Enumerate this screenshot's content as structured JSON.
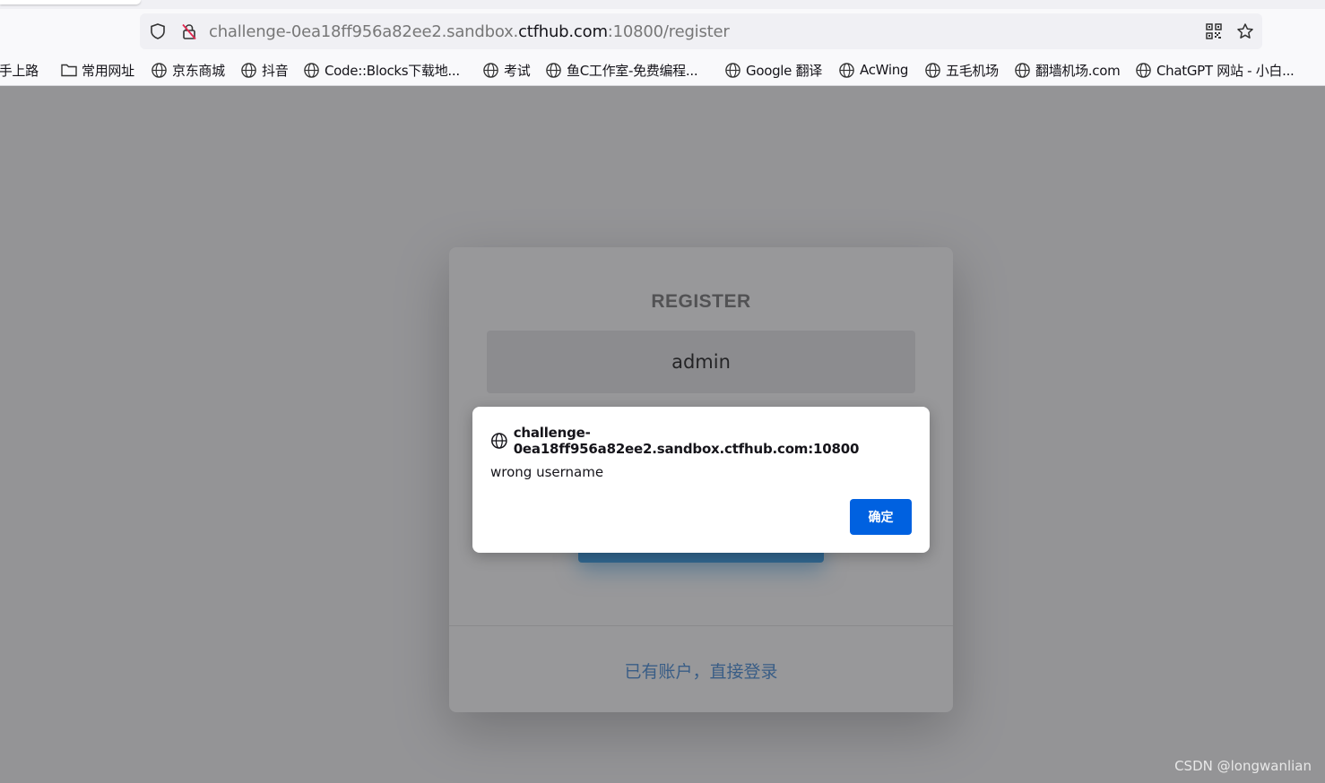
{
  "browser": {
    "url_prefix": "challenge-0ea18ff956a82ee2.sandbox.",
    "url_host": "ctfhub.com",
    "url_suffix": ":10800/register"
  },
  "bookmarks": [
    {
      "label": "新手上路",
      "icon": "none"
    },
    {
      "label": "常用网址",
      "icon": "folder-icon"
    },
    {
      "label": "京东商城",
      "icon": "globe-icon"
    },
    {
      "label": "抖音",
      "icon": "globe-icon"
    },
    {
      "label": "Code::Blocks下载地...",
      "icon": "globe-icon"
    },
    {
      "label": "考试",
      "icon": "globe-icon"
    },
    {
      "label": "鱼C工作室-免费编程...",
      "icon": "globe-icon"
    },
    {
      "label": "Google 翻译",
      "icon": "globe-icon"
    },
    {
      "label": "AcWing",
      "icon": "globe-icon"
    },
    {
      "label": "五毛机场",
      "icon": "globe-icon"
    },
    {
      "label": "翻墙机场.com",
      "icon": "globe-icon"
    },
    {
      "label": "ChatGPT 网站 - 小白...",
      "icon": "globe-icon"
    }
  ],
  "register": {
    "title": "REGISTER",
    "username_value": "admin",
    "login_link": "已有账户，直接登录"
  },
  "dialog": {
    "origin": "challenge-0ea18ff956a82ee2.sandbox.ctfhub.com:10800",
    "message": "wrong username",
    "ok_label": "确定"
  },
  "watermark": "CSDN @longwanlian",
  "colors": {
    "accent": "#0061e0",
    "submit": "#3aa0e8",
    "link": "#4a8fd8"
  }
}
